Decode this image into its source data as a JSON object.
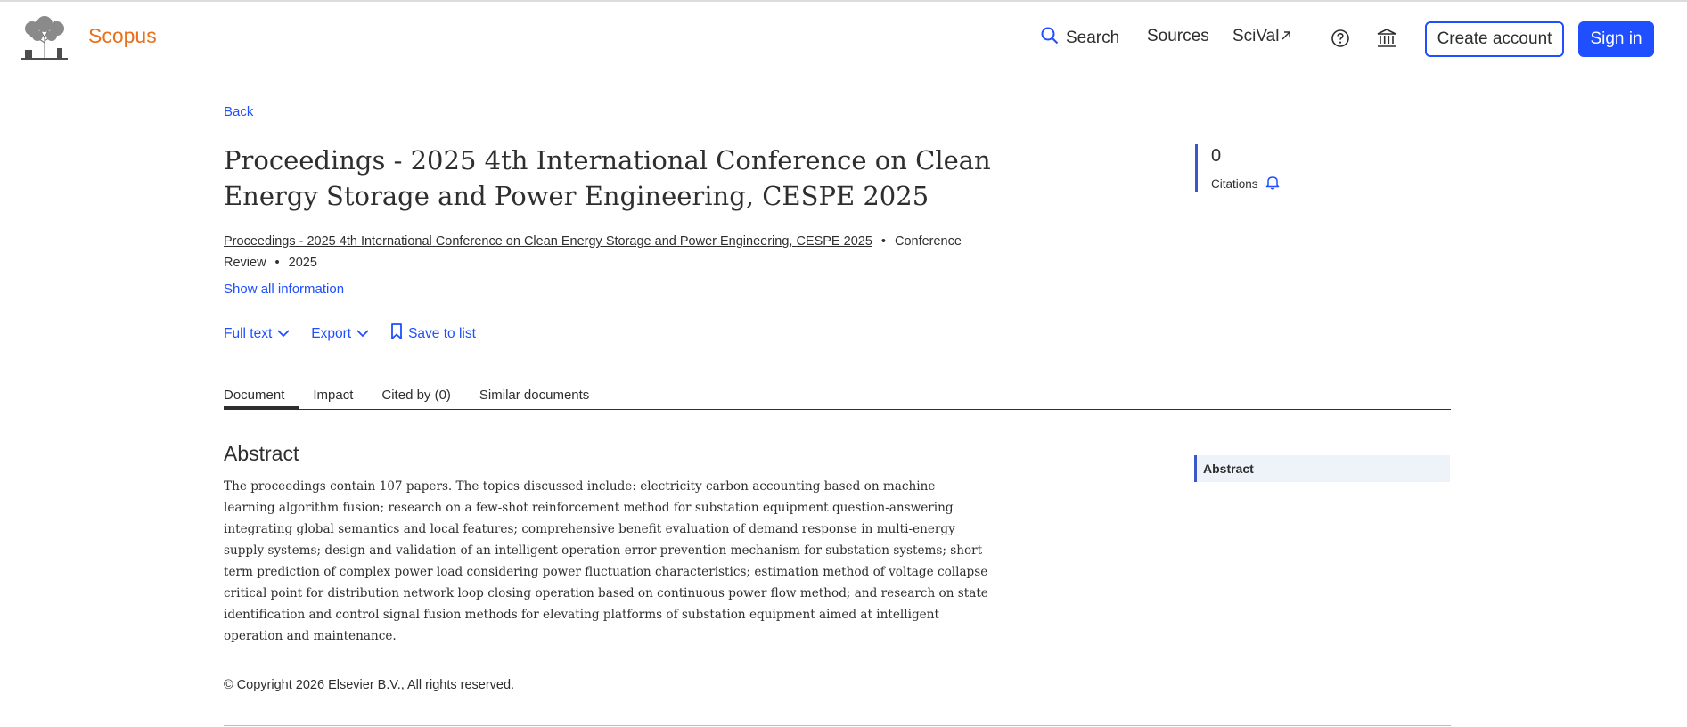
{
  "header": {
    "brand": "Scopus",
    "nav": {
      "search_label": "Search",
      "sources_label": "Sources",
      "scival_label": "SciVal"
    },
    "create_account_label": "Create account",
    "sign_in_label": "Sign in",
    "icons": {
      "search": "search-icon",
      "external": "external-link-icon",
      "help": "help-icon",
      "institution": "institution-icon"
    }
  },
  "document": {
    "back_label": "Back",
    "title": "Proceedings - 2025 4th International Conference on Clean Energy Storage and Power Engineering, CESPE 2025",
    "source_title": "Proceedings - 2025 4th International Conference on Clean Energy Storage and Power Engineering, CESPE 2025",
    "doc_type": "Conference Review",
    "year": "2025",
    "show_all_label": "Show all information",
    "actions": {
      "full_text": "Full text",
      "export": "Export",
      "save_to_list": "Save to list"
    }
  },
  "metrics": {
    "citations_count": "0",
    "citations_label": "Citations"
  },
  "tabs": [
    {
      "label": "Document",
      "active": true
    },
    {
      "label": "Impact",
      "active": false
    },
    {
      "label": "Cited by (0)",
      "active": false
    },
    {
      "label": "Similar documents",
      "active": false
    }
  ],
  "abstract": {
    "heading": "Abstract",
    "text": "The proceedings contain 107 papers. The topics discussed include: electricity carbon accounting based on machine learning algorithm fusion; research on a few-shot reinforcement method for substation equipment question-answering integrating global semantics and local features; comprehensive benefit evaluation of demand response in multi-energy supply systems; design and validation of an intelligent operation error prevention mechanism for substation systems; short term prediction of complex power load considering power fluctuation characteristics; estimation method of voltage collapse critical point for distribution network loop closing operation based on continuous power flow method; and research on state identification and control signal fusion methods for elevating platforms of substation equipment aimed at intelligent operation and maintenance."
  },
  "side_nav": {
    "abstract_label": "Abstract"
  },
  "footer": {
    "copyright": "© Copyright 2026 Elsevier B.V., All rights reserved."
  },
  "colors": {
    "brand_orange": "#e9711c",
    "link_blue": "#1f4fff",
    "accent_indigo": "#3b56c7"
  }
}
